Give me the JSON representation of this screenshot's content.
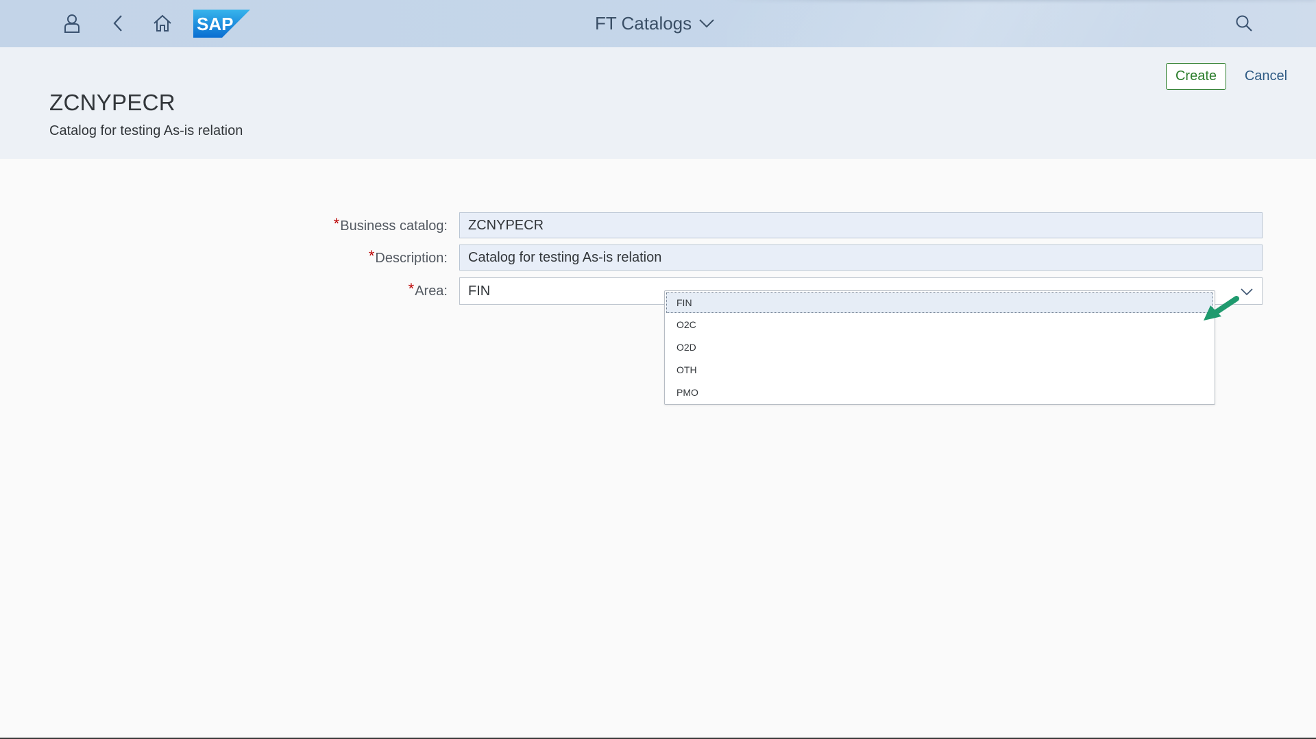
{
  "shell": {
    "title": "FT Catalogs",
    "logo_text": "SAP",
    "icons": [
      "user-icon",
      "back-icon",
      "home-icon",
      "search-icon",
      "chevron-down-icon"
    ]
  },
  "header": {
    "title": "ZCNYPECR",
    "subtitle": "Catalog for testing As-is relation",
    "create_label": "Create",
    "cancel_label": "Cancel"
  },
  "form": {
    "required_marker": "*",
    "business_catalog": {
      "label": "Business catalog:",
      "value": "ZCNYPECR"
    },
    "description": {
      "label": "Description:",
      "value": "Catalog for testing As-is relation"
    },
    "area": {
      "label": "Area:",
      "value": "FIN"
    }
  },
  "dropdown": {
    "options": [
      "FIN",
      "O2C",
      "O2D",
      "OTH",
      "PMO"
    ],
    "selected": "FIN"
  },
  "colors": {
    "shell_bg": "#c3d4e8",
    "header_bg": "#edf1f6",
    "accent_green": "#2b7d2b",
    "link_blue": "#2f5b84",
    "required_red": "#bb0000",
    "annotation_arrow": "#1f9a6e"
  }
}
